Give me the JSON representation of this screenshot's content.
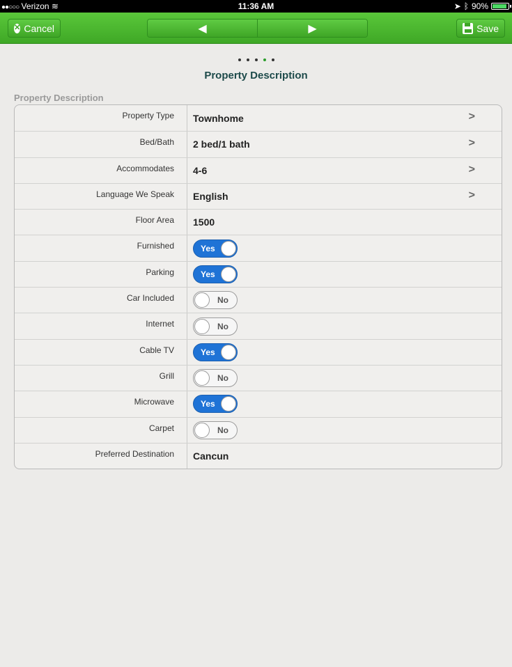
{
  "status": {
    "carrier_dots": "●●○○○",
    "carrier": "Verizon",
    "time": "11:36 AM",
    "battery": "90%",
    "battery_level": 0.9
  },
  "nav": {
    "cancel_label": "Cancel",
    "save_label": "Save",
    "prev_glyph": "◀",
    "next_glyph": "▶"
  },
  "page_indicator": {
    "count": 5,
    "active_index": 3
  },
  "title": "Property Description",
  "section_label": "Property Description",
  "rows": [
    {
      "label": "Property Type",
      "type": "select",
      "value": "Townhome"
    },
    {
      "label": "Bed/Bath",
      "type": "select",
      "value": "2 bed/1 bath"
    },
    {
      "label": "Accommodates",
      "type": "select",
      "value": "4-6"
    },
    {
      "label": "Language We Speak",
      "type": "select",
      "value": "English"
    },
    {
      "label": "Floor Area",
      "type": "text",
      "value": "1500"
    },
    {
      "label": "Furnished",
      "type": "toggle",
      "on": true,
      "value": "Yes"
    },
    {
      "label": "Parking",
      "type": "toggle",
      "on": true,
      "value": "Yes"
    },
    {
      "label": "Car Included",
      "type": "toggle",
      "on": false,
      "value": "No"
    },
    {
      "label": "Internet",
      "type": "toggle",
      "on": false,
      "value": "No"
    },
    {
      "label": "Cable TV",
      "type": "toggle",
      "on": true,
      "value": "Yes"
    },
    {
      "label": "Grill",
      "type": "toggle",
      "on": false,
      "value": "No"
    },
    {
      "label": "Microwave",
      "type": "toggle",
      "on": true,
      "value": "Yes"
    },
    {
      "label": "Carpet",
      "type": "toggle",
      "on": false,
      "value": "No"
    },
    {
      "label": "Preferred Destination",
      "type": "text",
      "value": "Cancun"
    }
  ],
  "colors": {
    "nav_green": "#4cbb30",
    "toggle_on": "#1f73d6",
    "title": "#1d4a4a"
  }
}
